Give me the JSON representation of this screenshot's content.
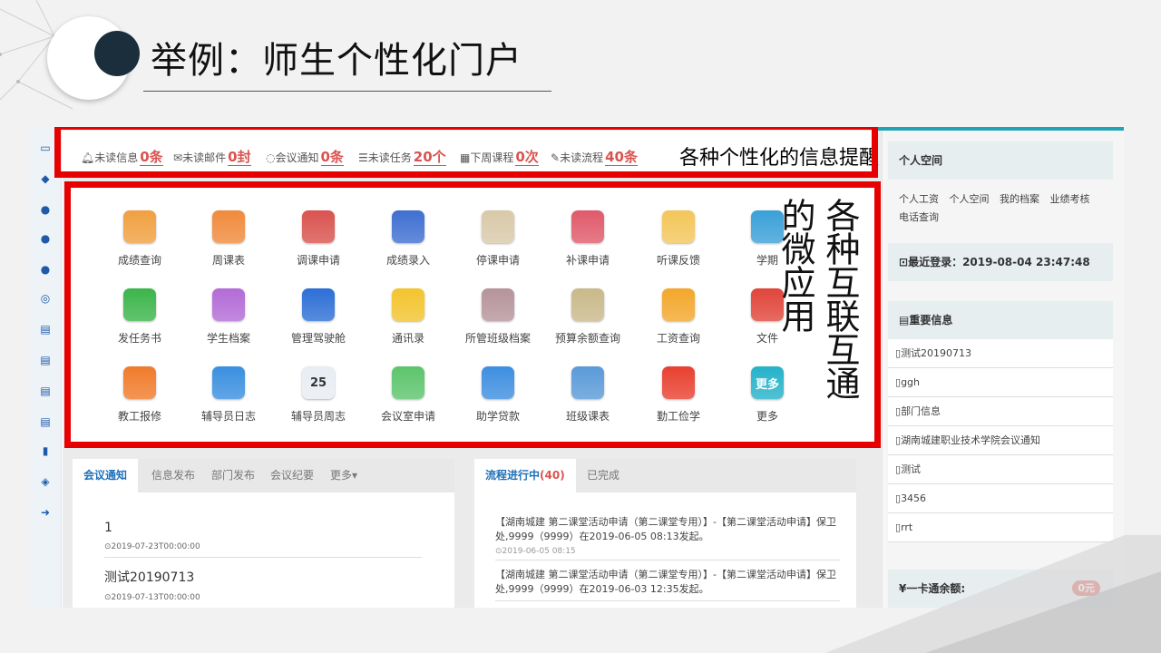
{
  "slide": {
    "title": "举例：师生个性化门户"
  },
  "notifications": [
    {
      "icon": "bell-icon",
      "label": "未读信息",
      "count": "0条"
    },
    {
      "icon": "mail-icon",
      "label": "未读邮件",
      "count": "0封"
    },
    {
      "icon": "chat-icon",
      "label": "会议通知",
      "count": "0条"
    },
    {
      "icon": "list-icon",
      "label": "未读任务",
      "count": "20个"
    },
    {
      "icon": "calendar-icon",
      "label": "下周课程",
      "count": "0次"
    },
    {
      "icon": "edit-icon",
      "label": "未读流程",
      "count": "40条"
    }
  ],
  "annotations": {
    "notify": "各种个性化的信息提醒",
    "apps_col1": "各种互联互通",
    "apps_col2": "的微应用"
  },
  "apps": [
    {
      "label": "成绩查询",
      "icon": "magnifier-icon",
      "color": "#f0a040"
    },
    {
      "label": "周课表",
      "icon": "schedule-icon",
      "color": "#f08a3c"
    },
    {
      "label": "调课申请",
      "icon": "user-swap-icon",
      "color": "#d9534f"
    },
    {
      "label": "成绩录入",
      "icon": "grid-icon",
      "color": "#3f6fd1"
    },
    {
      "label": "停课申请",
      "icon": "pen-paper-icon",
      "color": "#d8c9a8"
    },
    {
      "label": "补课申请",
      "icon": "notebook-icon",
      "color": "#e05a6a"
    },
    {
      "label": "听课反馈",
      "icon": "feedback-icon",
      "color": "#f3c65a"
    },
    {
      "label": "学期",
      "icon": "book-icon",
      "color": "#3aa0d8"
    },
    {
      "label": "发任务书",
      "icon": "document-plus-icon",
      "color": "#3bb54a"
    },
    {
      "label": "学生档案",
      "icon": "chart-icon",
      "color": "#b36bd6"
    },
    {
      "label": "管理驾驶舱",
      "icon": "wheel-icon",
      "color": "#2d6fd6"
    },
    {
      "label": "通讯录",
      "icon": "phone-book-icon",
      "color": "#f2c42e"
    },
    {
      "label": "所管班级档案",
      "icon": "id-cards-icon",
      "color": "#b5949a"
    },
    {
      "label": "预算余额查询",
      "icon": "yen-icon",
      "color": "#c9b98a"
    },
    {
      "label": "工资查询",
      "icon": "card-icon",
      "color": "#f3a72c"
    },
    {
      "label": "文件",
      "icon": "file-icon",
      "color": "#e0453a"
    },
    {
      "label": "教工报修",
      "icon": "tools-icon",
      "color": "#f07b2a"
    },
    {
      "label": "辅导员日志",
      "icon": "sun-icon",
      "color": "#3a8fe0"
    },
    {
      "label": "辅导员周志",
      "icon": "calendar-25-icon",
      "color": "#e8edf3",
      "text": "25"
    },
    {
      "label": "会议室申请",
      "icon": "notepad-icon",
      "color": "#5cc46c"
    },
    {
      "label": "助学贷款",
      "icon": "cards-icon",
      "color": "#3e8ee0"
    },
    {
      "label": "班级课表",
      "icon": "magnifier-board-icon",
      "color": "#5a9ad8"
    },
    {
      "label": "勤工俭学",
      "icon": "worker-icon",
      "color": "#e8402f"
    },
    {
      "label": "更多",
      "icon": "more-icon",
      "color": "#25b2c9",
      "text": "更多"
    }
  ],
  "meeting_panel": {
    "tabs": [
      "会议通知",
      "信息发布",
      "部门发布",
      "会议纪要",
      "更多▾"
    ],
    "items": [
      {
        "title": "1",
        "date": "⊙2019-07-23T00:00:00"
      },
      {
        "title": "测试20190713",
        "date": "⊙2019-07-13T00:00:00"
      }
    ]
  },
  "flow_panel": {
    "tab_active_label": "流程进行中",
    "tab_active_count": "(40)",
    "tab_done": "已完成",
    "items": [
      {
        "text": "【湖南城建 第二课堂活动申请（第二课堂专用）】-【第二课堂活动申请】保卫处,9999（9999）在2019-06-05 08:13发起。",
        "date": "⊙2019-06-05 08:15"
      },
      {
        "text": "【湖南城建 第二课堂活动申请（第二课堂专用）】-【第二课堂活动申请】保卫处,9999（9999）在2019-06-03 12:35发起。",
        "date": ""
      }
    ]
  },
  "right_col": {
    "personal_title": "个人空间",
    "personal_links": [
      "个人工资",
      "个人空间",
      "我的档案",
      "业绩考核",
      "电话查询"
    ],
    "last_login": "最近登录：2019-08-04 23:47:48",
    "important_title": "重要信息",
    "important_items": [
      "测试20190713",
      "ggh",
      "部门信息",
      "湖南城建职业技术学院会议通知",
      "测试",
      "3456",
      "rrt"
    ],
    "card_label": "¥一卡通余额:",
    "card_value": "0元"
  },
  "colors": {
    "accent": "#1e6fb8",
    "alert_red": "#e60000",
    "count_red": "#d9534f",
    "top_bar": "#20a3b6"
  }
}
